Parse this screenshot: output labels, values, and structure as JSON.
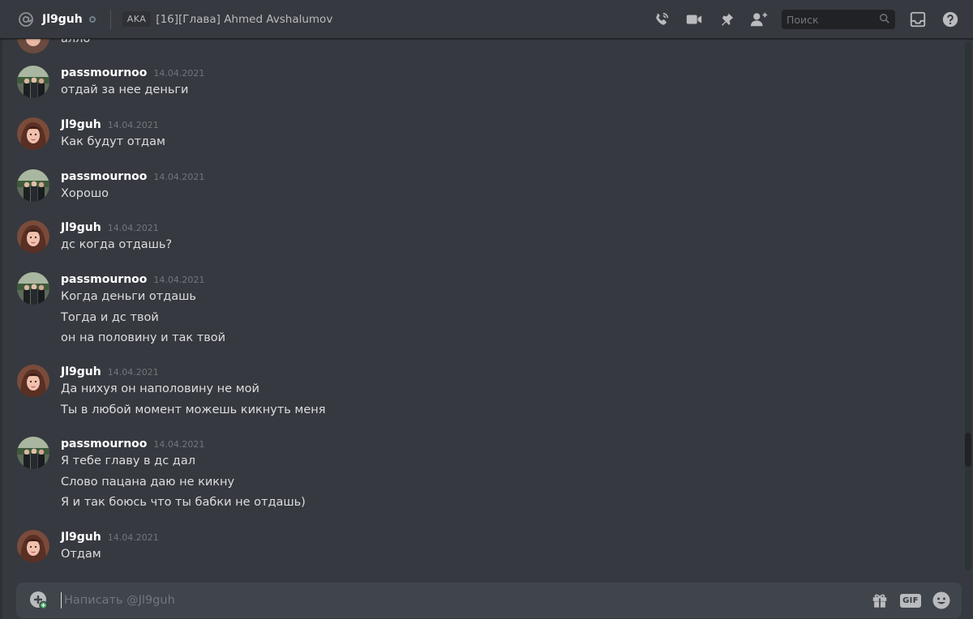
{
  "header": {
    "dm_name": "Jl9guh",
    "tag": "AKA",
    "topic": "[16][Глава] Ahmed Avshalumov",
    "search_placeholder": "Поиск"
  },
  "icons": {
    "at": "at-sign-icon",
    "call": "voice-call-icon",
    "video": "video-call-icon",
    "pin": "pin-icon",
    "add_friend": "add-friend-icon",
    "search": "search-icon",
    "inbox": "inbox-icon",
    "help": "help-icon",
    "attach": "attach-plus-icon",
    "gift": "gift-icon",
    "emoji": "emoji-icon"
  },
  "colors": {
    "background": "#36393f",
    "header_border": "#202225",
    "composer": "#40444b",
    "username": "#ffffff",
    "timestamp": "#72767d"
  },
  "messages": {
    "partial_top": "алло",
    "groups": [
      {
        "author": "passmournoo",
        "time": "14.04.2021",
        "lines": [
          "отдай за нее деньги"
        ]
      },
      {
        "author": "Jl9guh",
        "time": "14.04.2021",
        "lines": [
          "Как будут отдам"
        ]
      },
      {
        "author": "passmournoo",
        "time": "14.04.2021",
        "lines": [
          "Хорошо"
        ]
      },
      {
        "author": "Jl9guh",
        "time": "14.04.2021",
        "lines": [
          "дс когда отдашь?"
        ]
      },
      {
        "author": "passmournoo",
        "time": "14.04.2021",
        "lines": [
          "Когда деньги отдашь",
          "Тогда и дс твой",
          "он на половину и так твой"
        ]
      },
      {
        "author": "Jl9guh",
        "time": "14.04.2021",
        "lines": [
          "Да нихуя он наполовину не мой",
          "Ты в любой момент можешь кикнуть меня"
        ]
      },
      {
        "author": "passmournoo",
        "time": "14.04.2021",
        "lines": [
          "Я тебе главу в дс дал",
          "Слово пацана даю не кикну",
          "Я и так боюсь что ты бабки не отдашь)"
        ]
      },
      {
        "author": "Jl9guh",
        "time": "14.04.2021",
        "lines": [
          "Отдам"
        ]
      }
    ]
  },
  "composer": {
    "placeholder": "Написать @Jl9guh",
    "gif_label": "GIF"
  }
}
